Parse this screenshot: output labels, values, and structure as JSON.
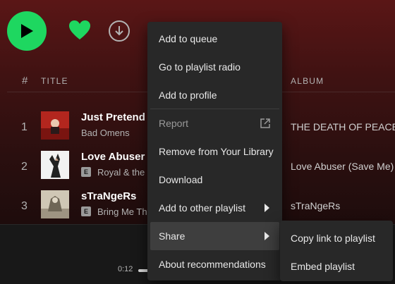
{
  "table_header": {
    "hash": "#",
    "title": "TITLE",
    "album": "ALBUM"
  },
  "tracks": [
    {
      "num": "1",
      "title": "Just Pretend",
      "artist": "Bad Omens",
      "explicit": false,
      "album": "THE DEATH OF PEACE"
    },
    {
      "num": "2",
      "title": "Love Abuser",
      "artist": "Royal & the",
      "explicit": true,
      "explicit_label": "E",
      "album": "Love Abuser (Save Me)"
    },
    {
      "num": "3",
      "title": "sTraNgeRs",
      "artist": "Bring Me Th",
      "explicit": true,
      "explicit_label": "E",
      "album": "sTraNgeRs"
    }
  ],
  "player": {
    "elapsed": "0:12"
  },
  "context_menu": {
    "items": [
      {
        "label": "Add to queue"
      },
      {
        "label": "Go to playlist radio"
      },
      {
        "label": "Add to profile"
      },
      {
        "label": "Report"
      },
      {
        "label": "Remove from Your Library"
      },
      {
        "label": "Download"
      },
      {
        "label": "Add to other playlist"
      },
      {
        "label": "Share"
      },
      {
        "label": "About recommendations"
      }
    ]
  },
  "share_submenu": {
    "items": [
      {
        "label": "Copy link to playlist"
      },
      {
        "label": "Embed playlist"
      }
    ]
  },
  "colors": {
    "accent": "#1ed760",
    "menu_bg": "#282828",
    "menu_hover": "#3e3e3e"
  }
}
